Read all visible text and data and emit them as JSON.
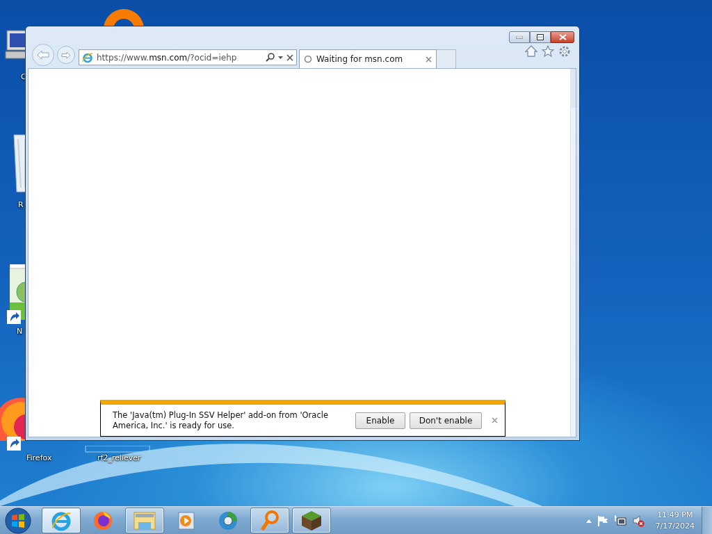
{
  "desktop_icons": [
    {
      "kind": "computer",
      "label": "C"
    },
    {
      "kind": "ring"
    },
    {
      "kind": "recycle-bin",
      "label": "R"
    },
    {
      "kind": "app",
      "label": "N",
      "shortcut": true
    },
    {
      "kind": "firefox",
      "label": "Firefox",
      "shortcut": true
    },
    {
      "kind": "blank",
      "label": "rf2_reliever"
    }
  ],
  "browser": {
    "address": "https://www.**msn.com**/?ocid=iehp",
    "tabs": [
      {
        "label": "Waiting for msn.com",
        "selected": true,
        "loading": true
      }
    ],
    "notification": {
      "message": "The 'Java(tm) Plug-In SSV Helper' add-on from 'Oracle America, Inc.' is ready for use.",
      "buttons": [
        "Enable",
        "Don't enable"
      ]
    }
  },
  "taskbar": {
    "items": [
      {
        "kind": "ie",
        "running": true,
        "selected": true
      },
      {
        "kind": "firefox",
        "running": false,
        "selected": false
      },
      {
        "kind": "folder",
        "running": true,
        "selected": false
      },
      {
        "kind": "media",
        "running": false,
        "selected": false
      },
      {
        "kind": "globe",
        "running": false,
        "selected": false
      },
      {
        "kind": "magnifier",
        "running": true,
        "selected": false
      },
      {
        "kind": "block",
        "running": true,
        "selected": false
      }
    ],
    "tray": {
      "volume_muted": true
    },
    "clock": {
      "time": "11:49 PM",
      "date": "7/17/2024"
    }
  }
}
